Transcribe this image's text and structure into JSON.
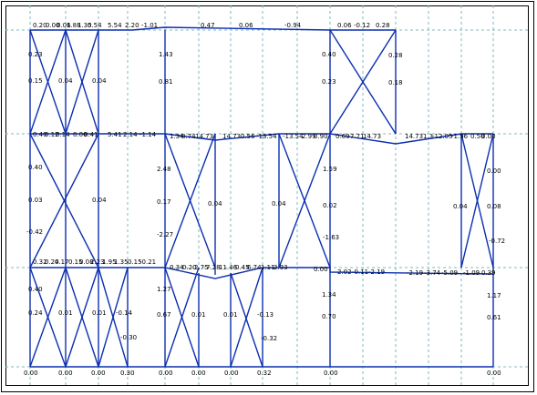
{
  "labels": {
    "L1": "0.20",
    "L2": "0.00",
    "L3": "0.06",
    "L4": "1.88",
    "L5": "1.35",
    "L6": "0.54",
    "L7": "5.54",
    "L8": "2.20",
    "L9": "-1.01",
    "L10": "0.47",
    "L11": "0.06",
    "L12": "-0.94",
    "L13": "0.06",
    "L14": "-0.12",
    "L15": "0.28",
    "L16": "0.23",
    "L17": "1.43",
    "L18": "0.40",
    "L19": "0.28",
    "L20": "0.15",
    "L21": "0.04",
    "L22": "0.04",
    "L23": "0.81",
    "L24": "0.23",
    "L25": "0.18",
    "L26": "0.40",
    "L27": "0.12",
    "L28": "0.14",
    "L29": "0.06",
    "L30": "0.41",
    "L31": "5.41",
    "L32": "2.14",
    "L33": "-1.14",
    "L34": "1.34",
    "L35": "8.74",
    "L36": "14.73",
    "L37": "14.73",
    "L38": "0.56",
    "L39": "-13.54",
    "L40": "-13.54",
    "L41": "2.99",
    "L42": "0.90",
    "L43": "0.69",
    "L44": "7.71",
    "L45": "14.73",
    "L46": "14.73",
    "L47": "1.3",
    "L48": "-12.05",
    "L49": "-1.96",
    "L50": "0.50",
    "L51": "0.00",
    "L52": "0.40",
    "L53": "2.48",
    "L54": "1.59",
    "L55": "0.00",
    "L56": "0.03",
    "L57": "0.04",
    "L58": "0.17",
    "L59": "0.04",
    "L60": "0.04",
    "L61": "0.02",
    "L62": "0.04",
    "L63": "0.08",
    "L64": "-0.42",
    "L65": "-2.27",
    "L66": "-1.63",
    "L67": "-0.72",
    "L68": "0.32",
    "L69": "0.24",
    "L70": "0.17",
    "L71": "0.15",
    "L72": "0.08",
    "L73": "2.23",
    "L74": "1.95",
    "L75": "1.35",
    "L76": "0.15",
    "L77": "-0.21",
    "L78": "0.34",
    "L79": "0.20",
    "L80": "2.75",
    "L81": "7.28",
    "L82": "11.46",
    "L83": "0.45",
    "L84": "6.74",
    "L85": "1.11",
    "L86": "2.93",
    "L87": "0.00",
    "L88": "2.02",
    "L89": "-0.11",
    "L90": "-2.19",
    "L91": "-2.19",
    "L92": "-3.74",
    "L93": "-5.09",
    "L94": "-1.09",
    "L95": "0.39",
    "L96": "0.40",
    "L97": "1.27",
    "L98": "1.34",
    "L99": "1.17",
    "L100": "0.24",
    "L101": "0.01",
    "L102": "0.01",
    "L103": "-0.14",
    "L104": "0.67",
    "L105": "0.01",
    "L106": "0.01",
    "L107": "-0.13",
    "L108": "0.70",
    "L109": "0.61",
    "L110": "-0.30",
    "L111": "-0.32",
    "L112": "0.00",
    "L113": "0.00",
    "L114": "0.00",
    "L115": "0.30",
    "L116": "0.00",
    "L117": "0.00",
    "L118": "0.00",
    "L119": "0.32",
    "L120": "0.00",
    "L121": "0.00"
  },
  "colors": {
    "frame": "#0b2fb0",
    "grid": "#7fb9c2",
    "text": "#000000"
  }
}
